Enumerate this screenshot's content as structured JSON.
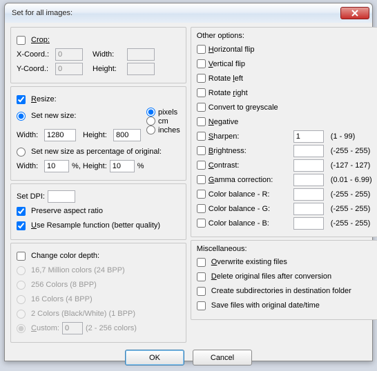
{
  "window": {
    "title": "Set for all images:"
  },
  "crop": {
    "label": "Crop:",
    "xcoord_label": "X-Coord.:",
    "xcoord": "0",
    "ycoord_label": "Y-Coord.:",
    "ycoord": "0",
    "width_label": "Width:",
    "width": "",
    "height_label": "Height:",
    "height": ""
  },
  "resize": {
    "label": "Resize:",
    "setnew_label": "Set new size:",
    "width_label": "Width:",
    "width": "1280",
    "height_label": "Height:",
    "height": "800",
    "unit_pixels": "pixels",
    "unit_cm": "cm",
    "unit_inches": "inches",
    "percent_label": "Set new size as percentage of original:",
    "pct_width_label": "Width:",
    "pct_width": "10",
    "pct_height_label": "%,  Height:",
    "pct_height": "10",
    "pct_sym": "%"
  },
  "dpi": {
    "label": "Set DPI:",
    "value": "",
    "preserve_label": "Preserve aspect ratio",
    "resample_label": "Use Resample function (better quality)"
  },
  "colordepth": {
    "label": "Change color depth:",
    "opt_16m": "16,7 Million colors (24 BPP)",
    "opt_256": "256 Colors (8 BPP)",
    "opt_16": "16 Colors (4 BPP)",
    "opt_2": "2 Colors (Black/White) (1 BPP)",
    "opt_custom": "Custom:",
    "custom_val": "0",
    "custom_range": "(2 - 256 colors)"
  },
  "other": {
    "header": "Other options:",
    "hflip": "Horizontal flip",
    "vflip": "Vertical flip",
    "rleft": "Rotate left",
    "rright": "Rotate right",
    "grey": "Convert to greyscale",
    "neg": "Negative",
    "sharpen_l": "Sharpen:",
    "sharpen_v": "1",
    "sharpen_r": "(1  -  99)",
    "bright_l": "Brightness:",
    "bright_v": "",
    "bright_r": "(-255  -  255)",
    "contrast_l": "Contrast:",
    "contrast_v": "",
    "contrast_r": "(-127  -  127)",
    "gamma_l": "Gamma correction:",
    "gamma_v": "",
    "gamma_r": "(0.01  -  6.99)",
    "cbr_l": "Color balance - R:",
    "cbr_v": "",
    "cbr_r": "(-255  -  255)",
    "cbg_l": "Color balance - G:",
    "cbg_v": "",
    "cbg_r": "(-255  -  255)",
    "cbb_l": "Color balance - B:",
    "cbb_v": "",
    "cbb_r": "(-255  -  255)"
  },
  "misc": {
    "header": "Miscellaneous:",
    "overwrite": "Overwrite existing files",
    "delete": "Delete original files after conversion",
    "subdirs": "Create subdirectories in destination folder",
    "origdate": "Save files with original date/time"
  },
  "buttons": {
    "ok": "OK",
    "cancel": "Cancel"
  }
}
